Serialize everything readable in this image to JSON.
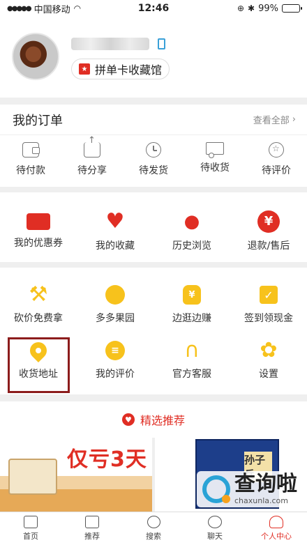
{
  "status_bar": {
    "carrier": "中国移动",
    "time": "12:46",
    "battery": "99%"
  },
  "profile": {
    "card_badge": "★",
    "card_label": "拼单卡收藏馆"
  },
  "orders": {
    "title": "我的订单",
    "view_all": "查看全部",
    "items": [
      {
        "label": "待付款",
        "icon": "wallet-icon"
      },
      {
        "label": "待分享",
        "icon": "share-icon"
      },
      {
        "label": "待发货",
        "icon": "clock-icon"
      },
      {
        "label": "待收货",
        "icon": "truck-icon"
      },
      {
        "label": "待评价",
        "icon": "review-icon"
      }
    ]
  },
  "favorites": {
    "items": [
      {
        "label": "我的优惠券",
        "icon": "coupon-icon"
      },
      {
        "label": "我的收藏",
        "icon": "heart-icon"
      },
      {
        "label": "历史浏览",
        "icon": "footprint-icon"
      },
      {
        "label": "退款/售后",
        "icon": "refund-icon"
      }
    ]
  },
  "tools": {
    "row1": [
      {
        "label": "砍价免费拿",
        "icon": "axe-icon"
      },
      {
        "label": "多多果园",
        "icon": "fruit-icon"
      },
      {
        "label": "边逛边赚",
        "icon": "money-bag-icon"
      },
      {
        "label": "签到领现金",
        "icon": "checkin-icon"
      }
    ],
    "row2": [
      {
        "label": "收货地址",
        "icon": "location-pin-icon"
      },
      {
        "label": "我的评价",
        "icon": "comment-icon"
      },
      {
        "label": "官方客服",
        "icon": "headset-icon"
      },
      {
        "label": "设置",
        "icon": "settings-icon"
      }
    ]
  },
  "recommend": {
    "label": "精选推荐"
  },
  "products": {
    "left_promo": "仅亏3天",
    "right_book_title": "孙子兵"
  },
  "watermark": {
    "text": "查询啦",
    "domain": "chaxunla.com"
  },
  "tabbar": {
    "items": [
      {
        "label": "首页",
        "icon": "home-icon"
      },
      {
        "label": "推荐",
        "icon": "recommend-icon"
      },
      {
        "label": "搜索",
        "icon": "search-icon"
      },
      {
        "label": "聊天",
        "icon": "chat-icon"
      },
      {
        "label": "个人中心",
        "icon": "profile-icon"
      }
    ],
    "active_index": 4
  },
  "colors": {
    "brand_red": "#e02e24",
    "accent_yellow": "#f7c21c",
    "highlight_border": "#8c1c1c"
  }
}
